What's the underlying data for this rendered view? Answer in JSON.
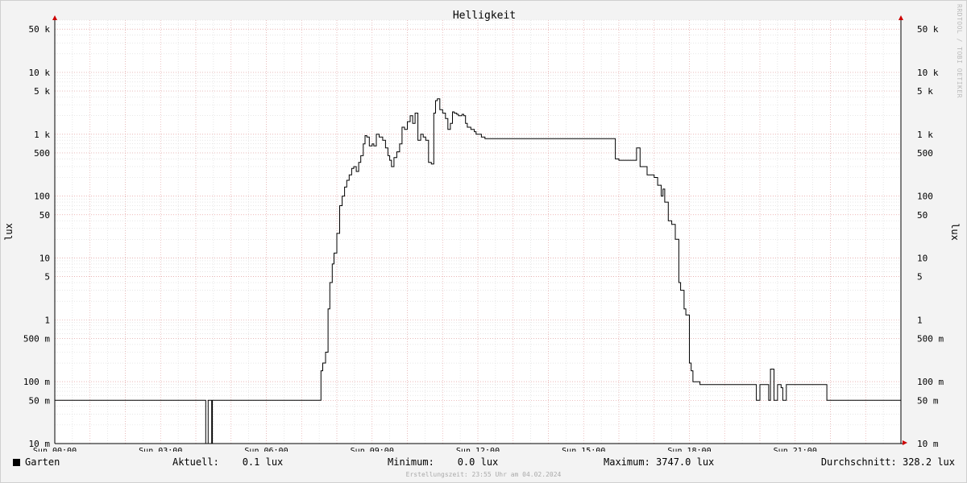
{
  "chart_data": {
    "type": "line",
    "title": "Helligkeit",
    "ylabel": "lux",
    "y_scale": "log",
    "ylim": [
      0.01,
      70000
    ],
    "xlim_hours": [
      0,
      24
    ],
    "y_ticks": [
      {
        "value": 0.01,
        "label": "10 m"
      },
      {
        "value": 0.05,
        "label": "50 m"
      },
      {
        "value": 0.1,
        "label": "100 m"
      },
      {
        "value": 0.5,
        "label": "500 m"
      },
      {
        "value": 1,
        "label": "1"
      },
      {
        "value": 5,
        "label": "5"
      },
      {
        "value": 10,
        "label": "10"
      },
      {
        "value": 50,
        "label": "50"
      },
      {
        "value": 100,
        "label": "100"
      },
      {
        "value": 500,
        "label": "500"
      },
      {
        "value": 1000,
        "label": "1 k"
      },
      {
        "value": 5000,
        "label": "5 k"
      },
      {
        "value": 10000,
        "label": "10 k"
      },
      {
        "value": 50000,
        "label": "50 k"
      }
    ],
    "x_ticks": [
      {
        "value": 0,
        "label": "Sun 00:00"
      },
      {
        "value": 3,
        "label": "Sun 03:00"
      },
      {
        "value": 6,
        "label": "Sun 06:00"
      },
      {
        "value": 9,
        "label": "Sun 09:00"
      },
      {
        "value": 12,
        "label": "Sun 12:00"
      },
      {
        "value": 15,
        "label": "Sun 15:00"
      },
      {
        "value": 18,
        "label": "Sun 18:00"
      },
      {
        "value": 21,
        "label": "Sun 21:00"
      }
    ],
    "grid": true,
    "series": [
      {
        "name": "Garten",
        "color": "#000000",
        "x": [
          0,
          4.27,
          4.28,
          4.33,
          4.35,
          4.45,
          4.47,
          4.6,
          7.5,
          7.55,
          7.6,
          7.68,
          7.75,
          7.8,
          7.87,
          7.92,
          8.0,
          8.08,
          8.15,
          8.22,
          8.28,
          8.35,
          8.42,
          8.48,
          8.55,
          8.62,
          8.68,
          8.75,
          8.8,
          8.85,
          8.92,
          9.0,
          9.05,
          9.12,
          9.2,
          9.3,
          9.38,
          9.45,
          9.5,
          9.55,
          9.62,
          9.7,
          9.78,
          9.85,
          9.92,
          10.0,
          10.08,
          10.15,
          10.22,
          10.3,
          10.38,
          10.45,
          10.52,
          10.6,
          10.68,
          10.75,
          10.8,
          10.85,
          10.92,
          11.0,
          11.08,
          11.15,
          11.22,
          11.28,
          11.33,
          11.4,
          11.45,
          11.55,
          11.6,
          11.65,
          11.7,
          11.8,
          11.9,
          11.95,
          12.05,
          12.1,
          12.2,
          12.3,
          12.4,
          12.45,
          12.55,
          12.65,
          12.75,
          12.9,
          13.2,
          13.4,
          13.5,
          13.8,
          14.0,
          14.5,
          15.0,
          15.5,
          15.9,
          16.0,
          16.4,
          16.5,
          16.6,
          16.8,
          17.0,
          17.1,
          17.2,
          17.25,
          17.3,
          17.4,
          17.5,
          17.6,
          17.7,
          17.75,
          17.85,
          17.9,
          18.0,
          18.05,
          18.1,
          18.3,
          18.5,
          19.0,
          19.5,
          19.9,
          20.0,
          20.15,
          20.25,
          20.3,
          20.4,
          20.5,
          20.6,
          20.65,
          20.75,
          20.8,
          20.9,
          21.2,
          21.5,
          21.9,
          22.0,
          22.5,
          23.0,
          24.0
        ],
        "values": [
          0.05,
          0.05,
          0.0,
          0.0,
          0.05,
          0.0,
          0.05,
          0.05,
          0.05,
          0.15,
          0.2,
          0.3,
          1.5,
          4.0,
          8.0,
          12.0,
          25.0,
          70.0,
          100.0,
          140.0,
          180.0,
          220.0,
          280.0,
          300.0,
          250.0,
          350.0,
          450.0,
          700.0,
          950.0,
          900.0,
          650.0,
          700.0,
          650.0,
          1000.0,
          900.0,
          800.0,
          600.0,
          450.0,
          380.0,
          300.0,
          420.0,
          520.0,
          700.0,
          1300.0,
          1200.0,
          1600.0,
          2000.0,
          1500.0,
          2200.0,
          800.0,
          1000.0,
          900.0,
          800.0,
          350.0,
          330.0,
          2200.0,
          3500.0,
          3747.0,
          2500.0,
          2200.0,
          1800.0,
          1200.0,
          1500.0,
          2300.0,
          2200.0,
          2100.0,
          2000.0,
          2100.0,
          2000.0,
          1500.0,
          1300.0,
          1200.0,
          1100.0,
          1000.0,
          1000.0,
          900.0,
          850.0,
          850.0,
          850.0,
          850.0,
          850.0,
          850.0,
          850.0,
          850.0,
          850.0,
          850.0,
          850.0,
          850.0,
          850.0,
          850.0,
          850.0,
          850.0,
          400.0,
          380.0,
          380.0,
          600.0,
          300.0,
          220.0,
          200.0,
          150.0,
          100.0,
          130.0,
          80.0,
          40.0,
          35.0,
          20.0,
          4.0,
          3.0,
          1.5,
          1.2,
          0.2,
          0.15,
          0.1,
          0.09,
          0.09,
          0.09,
          0.09,
          0.05,
          0.09,
          0.09,
          0.05,
          0.16,
          0.05,
          0.09,
          0.08,
          0.05,
          0.09,
          0.09,
          0.09,
          0.09,
          0.09,
          0.05,
          0.05,
          0.05,
          0.05,
          0.05
        ]
      }
    ]
  },
  "axis_unit_left": "lux",
  "axis_unit_right": "lux",
  "legend": {
    "series_name": "Garten",
    "current": "Aktuell:    0.1 lux",
    "minimum": "Minimum:    0.0 lux",
    "maximum": "Maximum: 3747.0 lux",
    "average": "Durchschnitt: 328.2 lux"
  },
  "footer": "Erstellungszeit: 23:55 Uhr am 04.02.2024",
  "watermark": "RRDTOOL / TOBI OETIKER",
  "colors": {
    "background": "#f3f3f3",
    "canvas": "#ffffff",
    "major_grid": "#e8a0a0",
    "minor_grid": "#d8d8d8",
    "line": "#000000",
    "axis_arrow": "#cc0000"
  }
}
